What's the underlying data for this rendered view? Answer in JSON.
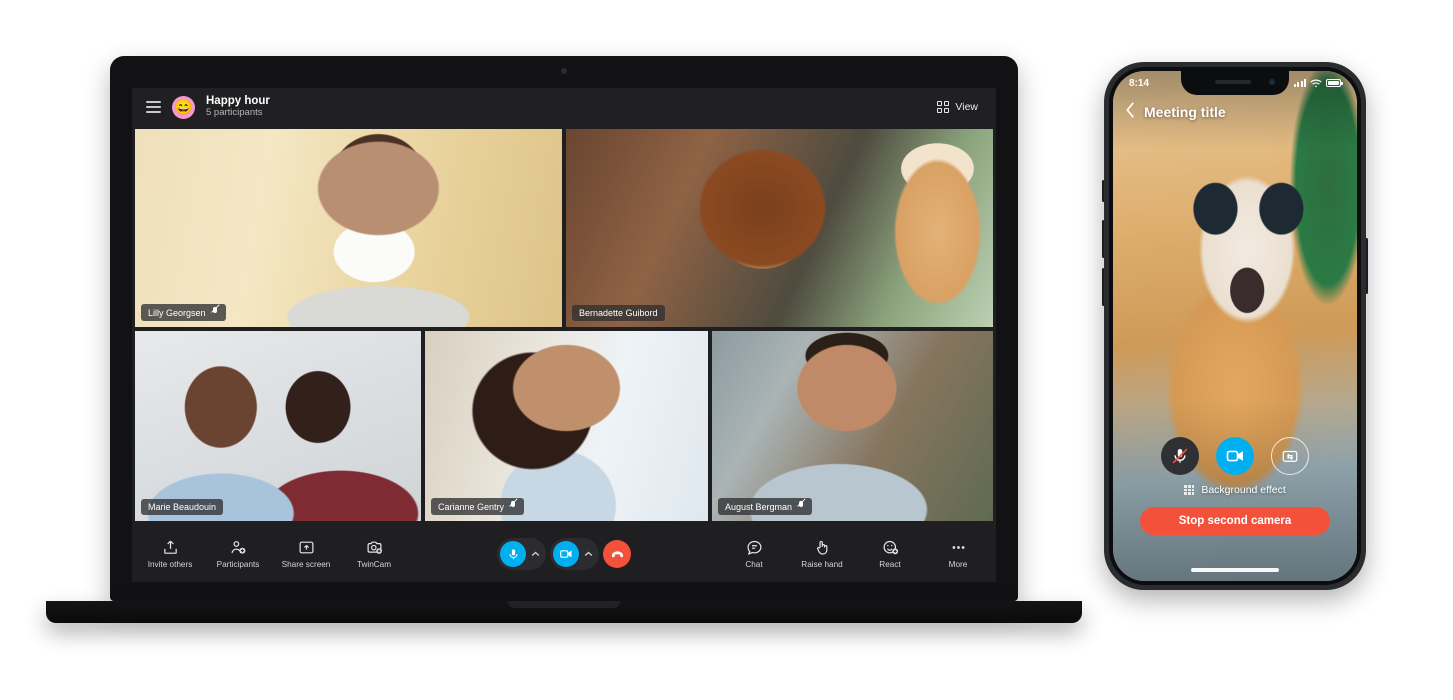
{
  "laptop": {
    "header": {
      "menu_icon": "hamburger-icon",
      "avatar_emoji": "😄",
      "title": "Happy hour",
      "subtitle": "5 participants",
      "view_label": "View",
      "view_icon": "grid-view-icon"
    },
    "tiles": [
      {
        "name": "Lilly Georgsen",
        "muted": true,
        "id": "lilly"
      },
      {
        "name": "Bernadette Guibord",
        "muted": false,
        "id": "bernadette"
      },
      {
        "name": "Marie Beaudouin",
        "muted": false,
        "id": "marie"
      },
      {
        "name": "Carianne Gentry",
        "muted": true,
        "id": "carianne"
      },
      {
        "name": "August Bergman",
        "muted": true,
        "id": "august"
      }
    ],
    "toolbar_left": [
      {
        "label": "Invite others",
        "icon": "share-upload-icon"
      },
      {
        "label": "Participants",
        "icon": "people-add-icon"
      },
      {
        "label": "Share screen",
        "icon": "screen-share-icon"
      },
      {
        "label": "TwinCam",
        "icon": "twincam-icon"
      }
    ],
    "toolbar_right": [
      {
        "label": "Chat",
        "icon": "chat-bubble-icon"
      },
      {
        "label": "Raise hand",
        "icon": "raise-hand-icon"
      },
      {
        "label": "React",
        "icon": "react-emoji-icon"
      },
      {
        "label": "More",
        "icon": "more-ellipsis-icon"
      }
    ],
    "center_controls": {
      "mic_icon": "microphone-icon",
      "mic_chevron_icon": "chevron-up-icon",
      "camera_icon": "video-camera-icon",
      "camera_chevron_icon": "chevron-up-icon",
      "hangup_icon": "end-call-icon"
    }
  },
  "phone": {
    "status": {
      "time": "8:14",
      "signal_icon": "signal-bars-icon",
      "wifi_icon": "wifi-icon",
      "battery_icon": "battery-full-icon"
    },
    "nav": {
      "back_icon": "chevron-left-icon",
      "title": "Meeting title"
    },
    "controls": {
      "mic_icon": "microphone-muted-icon",
      "camera_icon": "video-camera-icon",
      "switch_camera_icon": "camera-switch-icon",
      "background_effect_label": "Background effect",
      "background_effect_icon": "background-effect-icon",
      "stop_button_label": "Stop second camera"
    }
  },
  "colors": {
    "accent_blue": "#00aff0",
    "danger_red": "#f4513b",
    "app_bg": "#1f1f22",
    "header_bg": "#201f21",
    "avatar_pink": "#f29ad0"
  }
}
